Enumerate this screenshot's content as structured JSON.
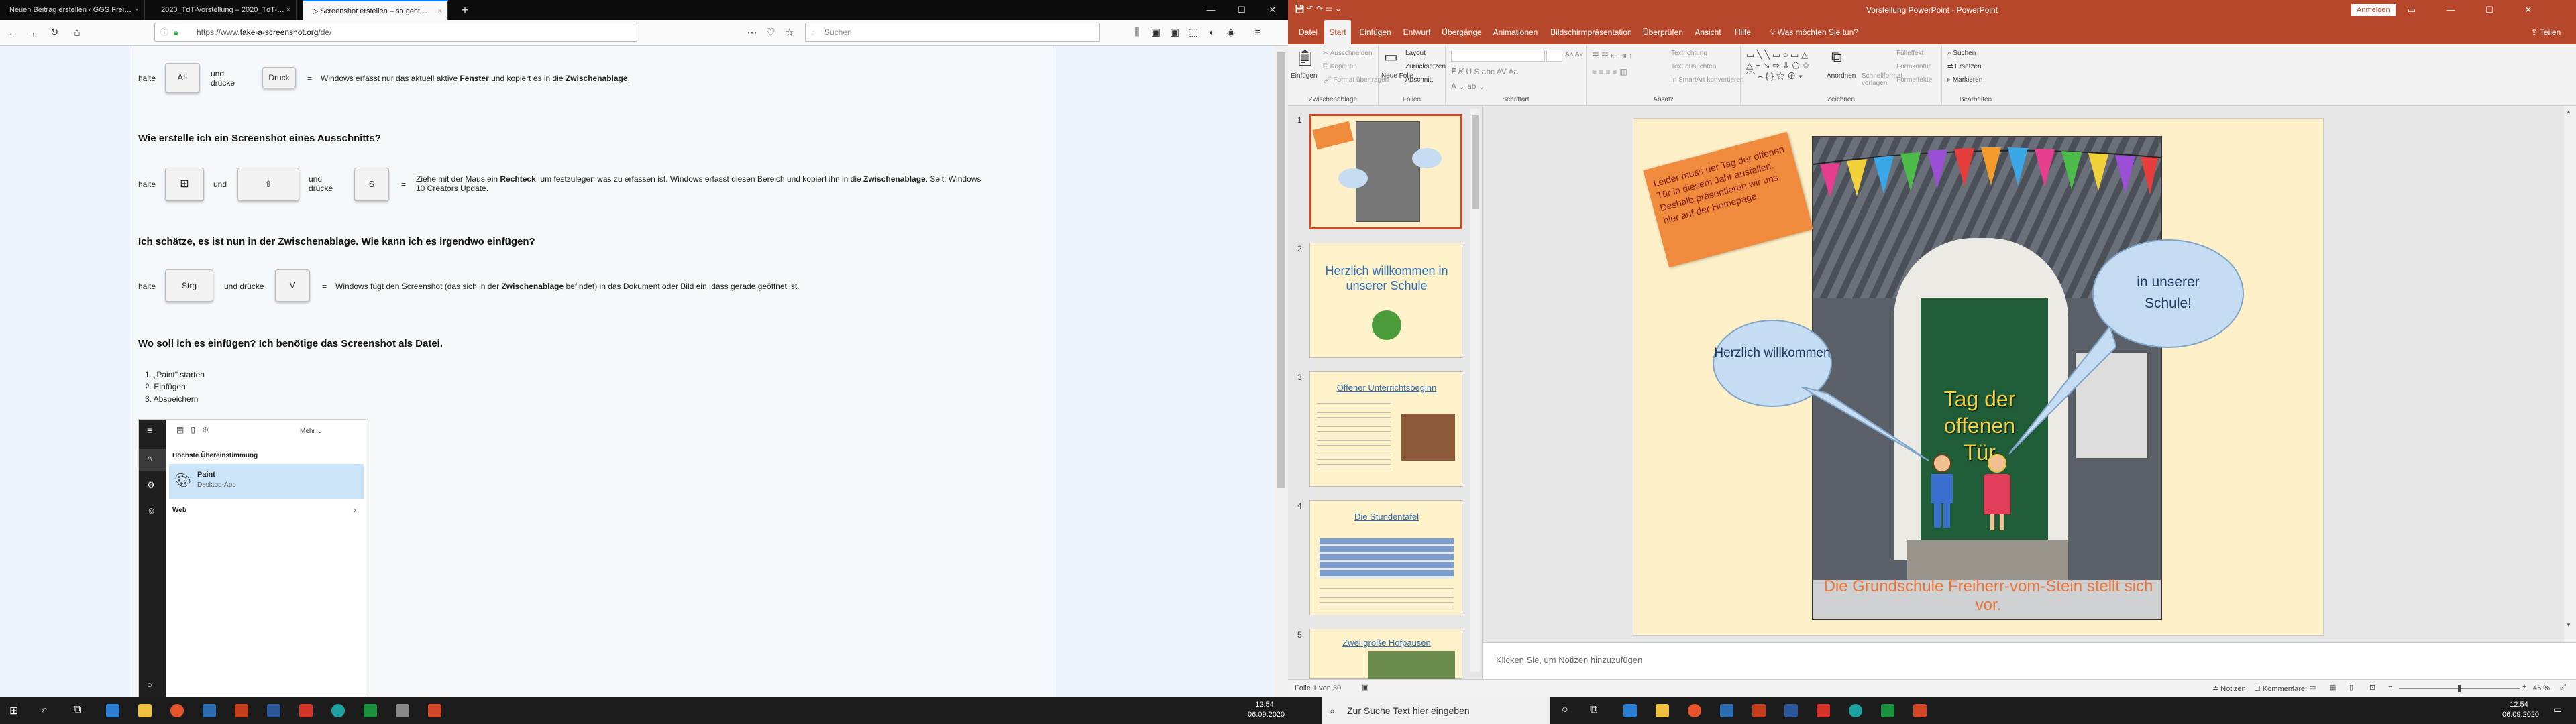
{
  "firefox": {
    "tabs": [
      "Neuen Beitrag erstellen ‹ GGS Frei…",
      "2020_TdT-Vorstellung – 2020_TdT-…",
      "▷ Screenshot erstellen – so geht…"
    ],
    "url_prefix": "https://www.",
    "url_domain": "take-a-screenshot.org",
    "url_suffix": "/de/",
    "search_placeholder": "Suchen"
  },
  "page": {
    "row1": {
      "halte": "halte",
      "key1": "Alt",
      "und": "und drücke",
      "key2": "Druck",
      "eq": "=",
      "desc_pre": "Windows erfasst nur das aktuell aktive ",
      "desc_b1": "Fenster",
      "desc_mid": " und kopiert es in die ",
      "desc_b2": "Zwischenablage",
      "desc_post": "."
    },
    "q1": "Wie erstelle ich ein Screenshot eines Ausschnitts?",
    "row2": {
      "halte": "halte",
      "und1": "und",
      "und2": "und drücke",
      "key3": "S",
      "eq": "=",
      "desc_pre": "Ziehe mit der Maus ein ",
      "desc_b1": "Rechteck",
      "desc_mid": ", um festzulegen was zu erfassen ist. Windows erfasst diesen Bereich und kopiert ihn in die ",
      "desc_b2": "Zwischenablage",
      "desc_post": ". Seit: Windows",
      "desc_line2": "10 Creators Update."
    },
    "q2": "Ich schätze, es ist nun in der Zwischenablage. Wie kann ich es irgendwo einfügen?",
    "row3": {
      "halte": "halte",
      "key1": "Strg",
      "und": "und drücke",
      "key2": "V",
      "eq": "=",
      "desc_pre": "Windows fügt den Screenshot (das sich in der ",
      "desc_b1": "Zwischenablage",
      "desc_post": " befindet) in das Dokument oder Bild ein, dass gerade geöffnet ist."
    },
    "q3": "Wo soll ich es einfügen? Ich benötige das Screenshot als Datei.",
    "steps": [
      "1. „Paint\" starten",
      "2. Einfügen",
      "3. Abspeichern"
    ],
    "winsearch": {
      "more": "Mehr",
      "best_match": "Höchste Übereinstimmung",
      "app_name": "Paint",
      "app_type": "Desktop-App",
      "web": "Web"
    }
  },
  "ppt": {
    "title": "Vorstellung PowerPoint  -  PowerPoint",
    "signin": "Anmelden",
    "share": "Teilen",
    "tabs": [
      "Datei",
      "Start",
      "Einfügen",
      "Entwurf",
      "Übergänge",
      "Animationen",
      "Bildschirmpräsentation",
      "Überprüfen",
      "Ansicht",
      "Hilfe",
      "Was möchten Sie tun?"
    ],
    "groups": [
      "Zwischenablage",
      "Folien",
      "Schriftart",
      "Absatz",
      "Zeichnen",
      "Bearbeiten"
    ],
    "ribbon": {
      "paste": "Einfügen",
      "cut": "Ausschneiden",
      "copy": "Kopieren",
      "format": "Format übertragen",
      "new_slide": "Neue Folie",
      "layout": "Layout",
      "reset": "Zurücksetzen",
      "section": "Abschnitt",
      "text_dir": "Textrichtung",
      "align_text": "Text ausrichten",
      "smartart": "In SmartArt konvertieren",
      "arrange": "Anordnen",
      "quick_styles": "Schnellformat-vorlagen",
      "fill": "Fülleffekt",
      "outline": "Formkontur",
      "effects": "Formeffekte",
      "find": "Suchen",
      "replace": "Ersetzen",
      "select": "Markieren"
    },
    "thumbs": {
      "n2_title": "Herzlich willkommen in unserer Schule",
      "n3_title": "Offener Unterrichtsbeginn",
      "n4_title": "Die Stundentafel",
      "n5_title": "Zwei große Hofpausen"
    },
    "slide": {
      "banner": "Leider muss der Tag der offenen Tür in diesem Jahr ausfallen. Deshalb präsentieren wir uns hier auf der Homepage.",
      "bubble1": "Herzlich willkommen",
      "bubble2": "in unserer Schule!",
      "door_text": "Tag der offenen Tür",
      "bottom": "Die Grundschule Freiherr-vom-Stein stellt sich vor."
    },
    "notes": "Klicken Sie, um Notizen hinzuzufügen",
    "status": "Folie 1 von 30",
    "status_notes": "Notizen",
    "status_comments": "Kommentare",
    "zoom": "46 %"
  },
  "taskbar": {
    "search": "Zur Suche Text hier eingeben",
    "time": "12:54",
    "date": "06.09.2020"
  }
}
